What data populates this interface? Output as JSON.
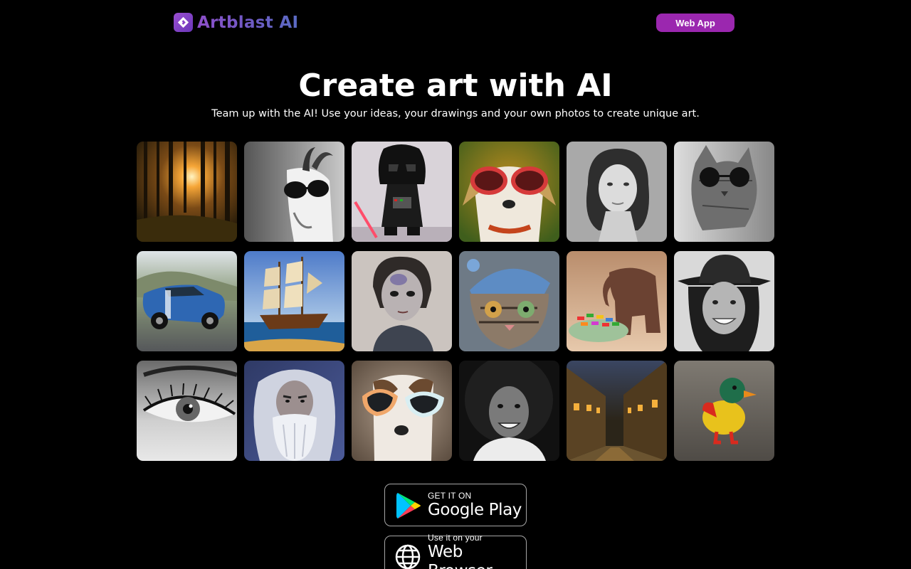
{
  "header": {
    "brand": "Artblast AI",
    "webapp_label": "Web App",
    "accent": "#9b27af"
  },
  "hero": {
    "title": "Create art with AI",
    "subtitle": "Team up with the AI! Use your ideas, your drawings and your own photos to create unique art."
  },
  "gallery": {
    "tiles": [
      {
        "subject": "forest-sunset"
      },
      {
        "subject": "goat-with-sunglasses"
      },
      {
        "subject": "darth-vader-figure"
      },
      {
        "subject": "dog-with-red-sunglasses"
      },
      {
        "subject": "woman-portrait"
      },
      {
        "subject": "cat-with-sunglasses"
      },
      {
        "subject": "blue-sports-car"
      },
      {
        "subject": "sailing-ship"
      },
      {
        "subject": "painted-woman-portrait"
      },
      {
        "subject": "cat-with-blue-hat"
      },
      {
        "subject": "wooden-elephant-with-candy"
      },
      {
        "subject": "smiling-woman-with-hat"
      },
      {
        "subject": "eye-closeup"
      },
      {
        "subject": "old-wizard"
      },
      {
        "subject": "dog-with-goggles"
      },
      {
        "subject": "smiling-woman-curly-hair"
      },
      {
        "subject": "night-street"
      },
      {
        "subject": "toy-duck"
      }
    ]
  },
  "stores": {
    "play_small": "GET IT ON",
    "play_big": "Google Play",
    "web_small": "Use it on your",
    "web_big": "Web Browser"
  }
}
